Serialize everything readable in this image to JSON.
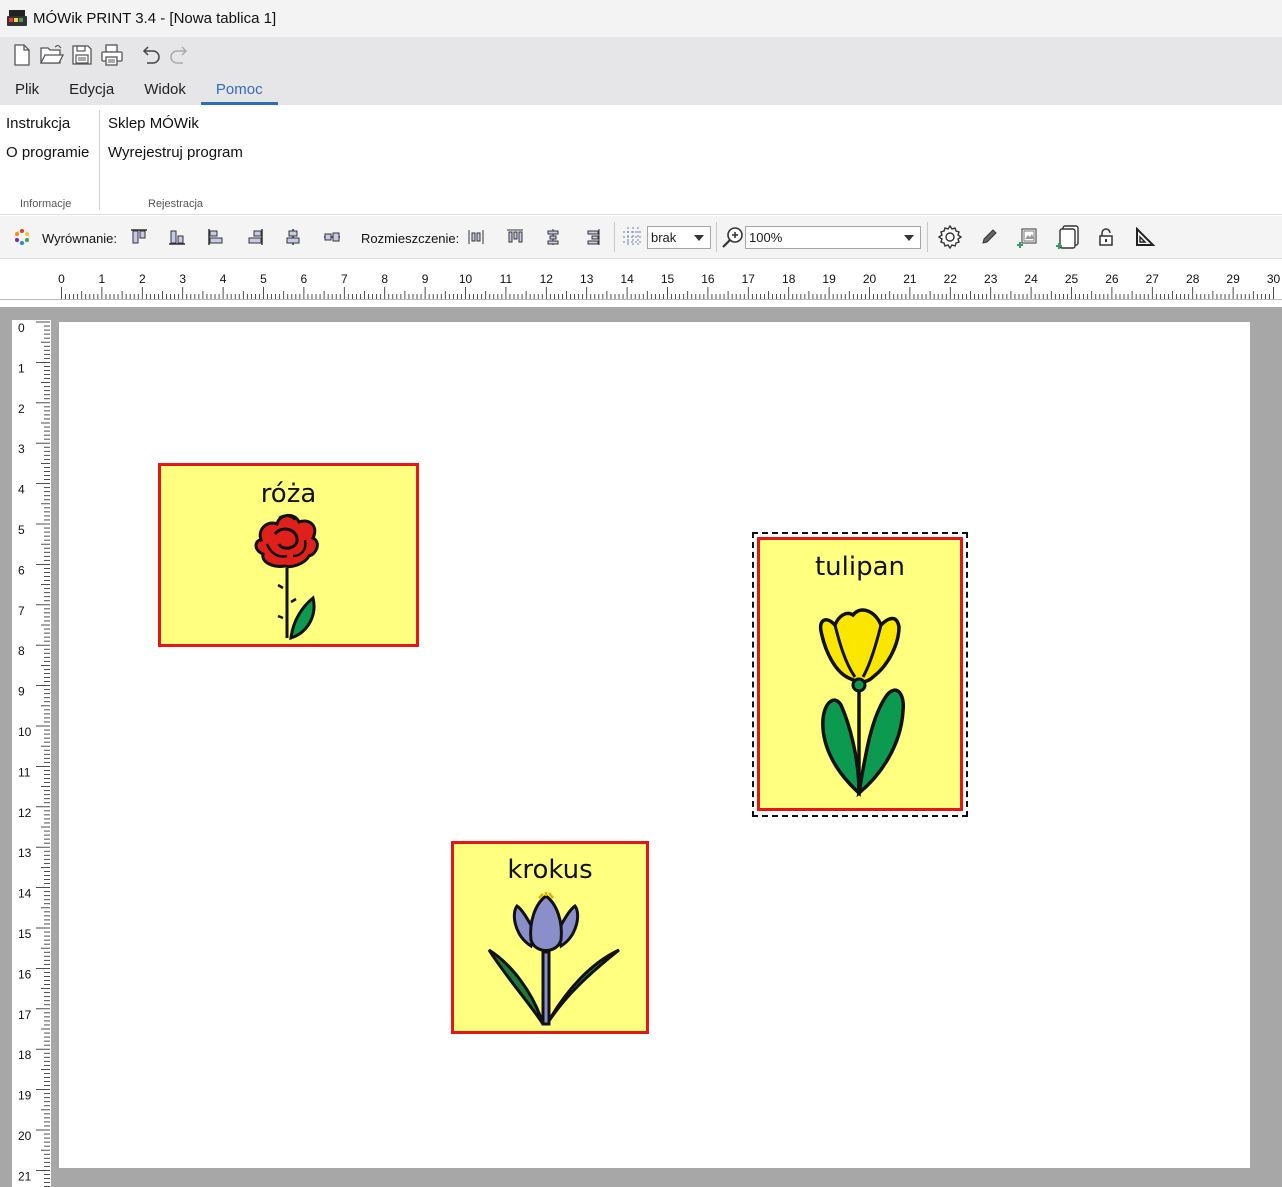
{
  "window": {
    "title": "MÓWik PRINT 3.4 - [Nowa tablica 1]"
  },
  "quick_access": [
    "new-file-icon",
    "open-folder-icon",
    "save-icon",
    "print-icon",
    "undo-icon",
    "redo-icon"
  ],
  "tabs": [
    {
      "label": "Plik"
    },
    {
      "label": "Edycja"
    },
    {
      "label": "Widok"
    },
    {
      "label": "Pomoc",
      "active": true
    }
  ],
  "ribbon": {
    "groups": [
      {
        "caption": "Informacje",
        "buttons": [
          "Instrukcja",
          "O programie"
        ]
      },
      {
        "caption": "Rejestracja",
        "buttons": [
          "Sklep MÓWik",
          "Wyrejestruj program"
        ]
      }
    ]
  },
  "toolbar": {
    "align_label": "Wyrównanie:",
    "distribute_label": "Rozmieszczenie:",
    "grid_value": "brak",
    "zoom_value": "100%"
  },
  "ruler": {
    "h_ticks": [
      "0",
      "1",
      "2",
      "3",
      "4",
      "5",
      "6",
      "7",
      "8",
      "9",
      "10",
      "11",
      "12",
      "13",
      "14",
      "15",
      "16",
      "17",
      "18",
      "19",
      "20",
      "21",
      "22",
      "23",
      "24",
      "25",
      "26",
      "27",
      "28",
      "29",
      "30"
    ],
    "v_ticks": [
      "0",
      "1",
      "2",
      "3",
      "4",
      "5",
      "6",
      "7",
      "8",
      "9",
      "10",
      "11",
      "12",
      "13",
      "14",
      "15",
      "16",
      "17",
      "18",
      "19",
      "20",
      "21"
    ]
  },
  "cards": [
    {
      "label": "róża",
      "symbol": "rose-symbol",
      "selected": false
    },
    {
      "label": "tulipan",
      "symbol": "tulip-symbol",
      "selected": true
    },
    {
      "label": "krokus",
      "symbol": "crocus-symbol",
      "selected": false
    }
  ],
  "colors": {
    "accent": "#2f6db5",
    "card_fill": "#ffff80",
    "card_border": "#e81515",
    "canvas_bg": "#a7a7a7"
  }
}
